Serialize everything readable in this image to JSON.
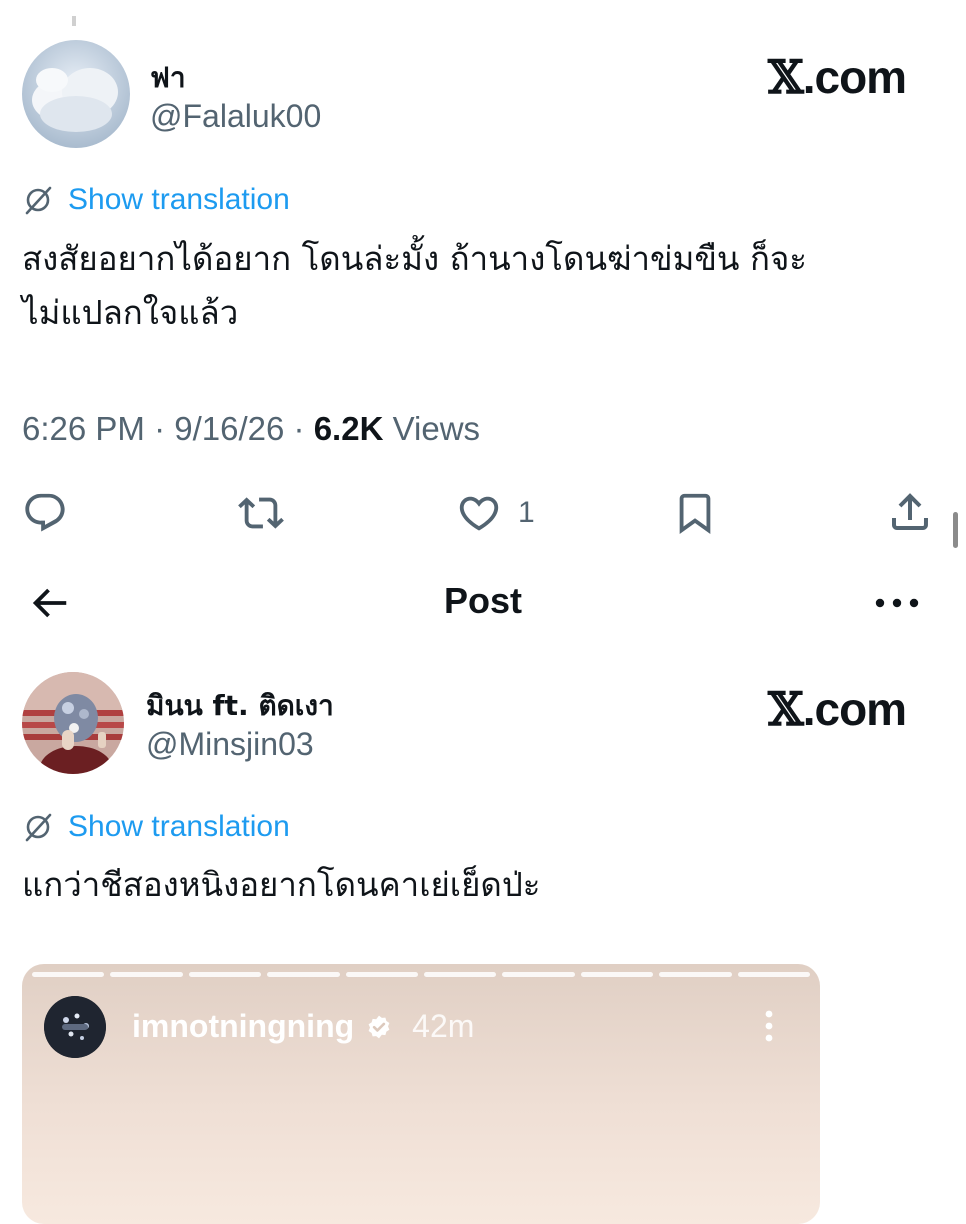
{
  "tweet1": {
    "display_name": "ฟา",
    "handle": "@Falaluk00",
    "brand": ".com",
    "translate_label": "Show translation",
    "text_line1": "สงสัยอยากได้อยาก โดนล่ะมั้ง ถ้านางโดนฆ่าข่มขืน ก็จะ",
    "text_line2": "ไม่แปลกใจแล้ว",
    "time": "6:26 PM",
    "date": "9/16/26",
    "views_count": "6.2K",
    "views_label": "Views",
    "like_count": "1"
  },
  "header": {
    "title": "Post"
  },
  "tweet2": {
    "display_name": "มินน ft. ติดเงา",
    "handle": "@Minsjin03",
    "brand": ".com",
    "translate_label": "Show translation",
    "text": "แกว่าชีสองหนิงอยากโดนคาเย่เย็ดป่ะ"
  },
  "story": {
    "username": "imnotningning",
    "age": "42m",
    "segments": 10
  },
  "colors": {
    "accent": "#1d9bf0",
    "text": "#0f1419",
    "muted": "#536471",
    "story_top": "#e1d1c7",
    "story_bottom": "#f6e7dd"
  },
  "icons": [
    "translate-icon",
    "reply-icon",
    "retweet-icon",
    "heart-icon",
    "bookmark-icon",
    "share-icon",
    "back-arrow-icon",
    "more-icon",
    "verified-icon",
    "kebab-icon"
  ]
}
